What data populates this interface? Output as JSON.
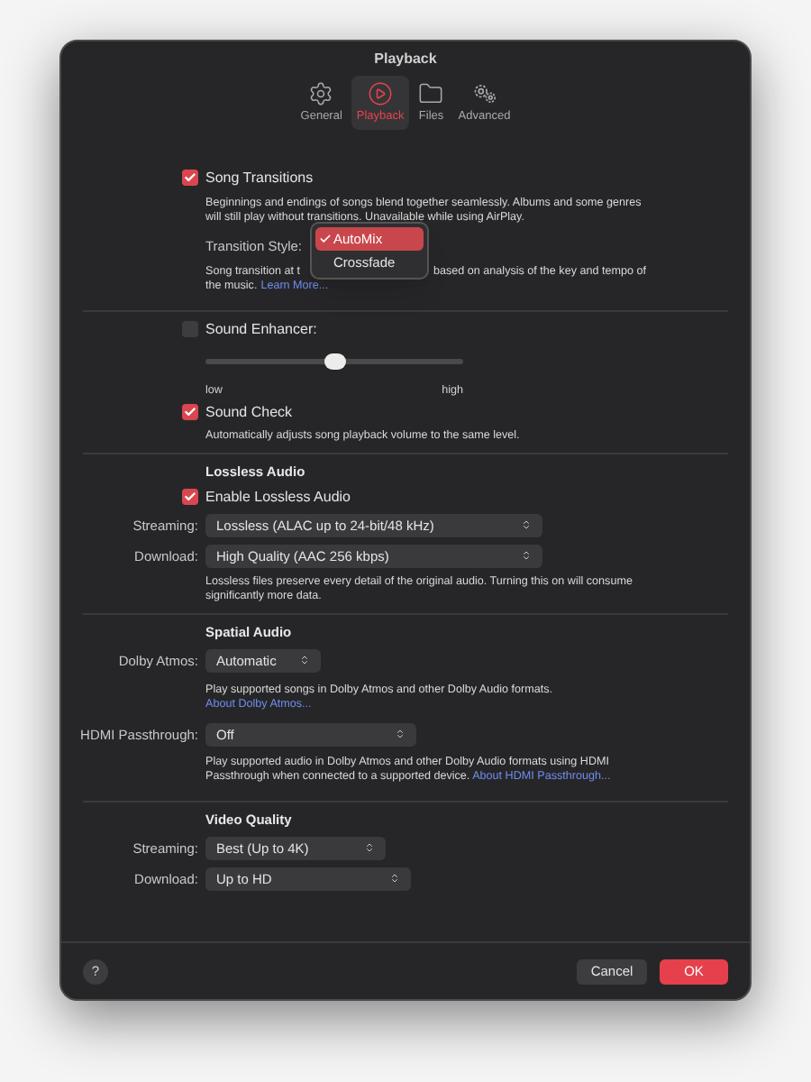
{
  "window": {
    "title": "Playback"
  },
  "toolbar": [
    {
      "label": "General",
      "selected": false
    },
    {
      "label": "Playback",
      "selected": true
    },
    {
      "label": "Files",
      "selected": false
    },
    {
      "label": "Advanced",
      "selected": false
    }
  ],
  "song_transitions": {
    "label": "Song Transitions",
    "checked": true,
    "description": "Beginnings and endings of songs blend together seamlessly. Albums and some genres will still play without transitions. Unavailable while using AirPlay.",
    "style_label": "Transition Style:",
    "menu": [
      {
        "label": "AutoMix",
        "selected": true
      },
      {
        "label": "Crossfade",
        "selected": false
      }
    ],
    "note_start": "Song transition at t",
    "note_end": "based on analysis of the key and tempo of",
    "note_line2": "the music.",
    "link": "Learn More..."
  },
  "sound_enhancer": {
    "label": "Sound Enhancer:",
    "checked": false,
    "level": 0.5,
    "min_label": "low",
    "max_label": "high"
  },
  "sound_check": {
    "label": "Sound Check",
    "checked": true,
    "description": "Automatically adjusts song playback volume to the same level."
  },
  "lossless": {
    "heading": "Lossless Audio",
    "enable": {
      "label": "Enable Lossless Audio",
      "checked": true
    },
    "fields": [
      {
        "label": "Streaming:",
        "value": "Lossless (ALAC up to 24-bit/48 kHz)"
      },
      {
        "label": "Download:",
        "value": "High Quality (AAC 256 kbps)"
      }
    ],
    "description": "Lossless files preserve every detail of the original audio. Turning this on will consume significantly more data."
  },
  "spatial": {
    "heading": "Spatial Audio",
    "fields": [
      {
        "label": "Dolby Atmos:",
        "value": "Automatic",
        "description": "Play supported songs in Dolby Atmos and other Dolby Audio formats.",
        "link": "About Dolby Atmos..."
      },
      {
        "label": "HDMI Passthrough:",
        "value": "Off",
        "description": "Play supported audio in Dolby Atmos and other Dolby Audio formats using HDMI Passthrough when connected to a supported device.",
        "link": "About HDMI Passthrough..."
      }
    ]
  },
  "video": {
    "heading": "Video Quality",
    "fields": [
      {
        "label": "Streaming:",
        "value": "Best (Up to 4K)"
      },
      {
        "label": "Download:",
        "value": "Up to HD"
      }
    ]
  },
  "footer": {
    "help": "?",
    "buttons": [
      {
        "label": "Cancel",
        "kind": "secondary"
      },
      {
        "label": "OK",
        "kind": "primary"
      }
    ]
  }
}
